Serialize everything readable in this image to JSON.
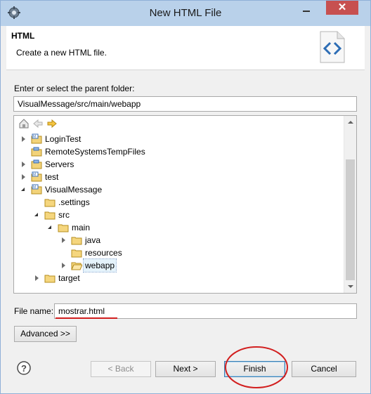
{
  "window": {
    "title": "New HTML File",
    "close_glyph": "✕",
    "app_icon": "gear-icon"
  },
  "banner": {
    "title": "HTML",
    "description": "Create a new HTML file.",
    "icon": "html-file-code-icon"
  },
  "parent_folder": {
    "label": "Enter or select the parent folder:",
    "value": "VisualMessage/src/main/webapp"
  },
  "tree": {
    "toolbar_icons": [
      "home-icon",
      "back-arrow-icon",
      "forward-arrow-icon"
    ],
    "items": [
      {
        "label": "LoginTest",
        "icon": "web-project-icon",
        "state": "collapsed"
      },
      {
        "label": "RemoteSystemsTempFiles",
        "icon": "project-folder-icon",
        "state": "leaf"
      },
      {
        "label": "Servers",
        "icon": "project-folder-icon",
        "state": "collapsed"
      },
      {
        "label": "test",
        "icon": "web-project-icon",
        "state": "collapsed"
      },
      {
        "label": "VisualMessage",
        "icon": "web-project-icon",
        "state": "expanded"
      },
      {
        "label": ".settings",
        "icon": "folder-icon",
        "state": "leaf"
      },
      {
        "label": "src",
        "icon": "folder-icon",
        "state": "expanded"
      },
      {
        "label": "main",
        "icon": "folder-icon",
        "state": "expanded"
      },
      {
        "label": "java",
        "icon": "folder-icon",
        "state": "collapsed"
      },
      {
        "label": "resources",
        "icon": "folder-icon",
        "state": "leaf"
      },
      {
        "label": "webapp",
        "icon": "folder-open-icon",
        "state": "collapsed",
        "selected": true
      },
      {
        "label": "target",
        "icon": "folder-icon",
        "state": "collapsed"
      }
    ]
  },
  "file_name": {
    "label": "File name:",
    "value": "mostrar.html"
  },
  "buttons": {
    "advanced": "Advanced >>",
    "back": "< Back",
    "next": "Next >",
    "finish": "Finish",
    "cancel": "Cancel",
    "help": "?"
  },
  "colors": {
    "titlebar": "#b9d1ea",
    "close": "#c75050",
    "annotation_red": "#d21f1f",
    "selection": "#e5f3fb"
  }
}
